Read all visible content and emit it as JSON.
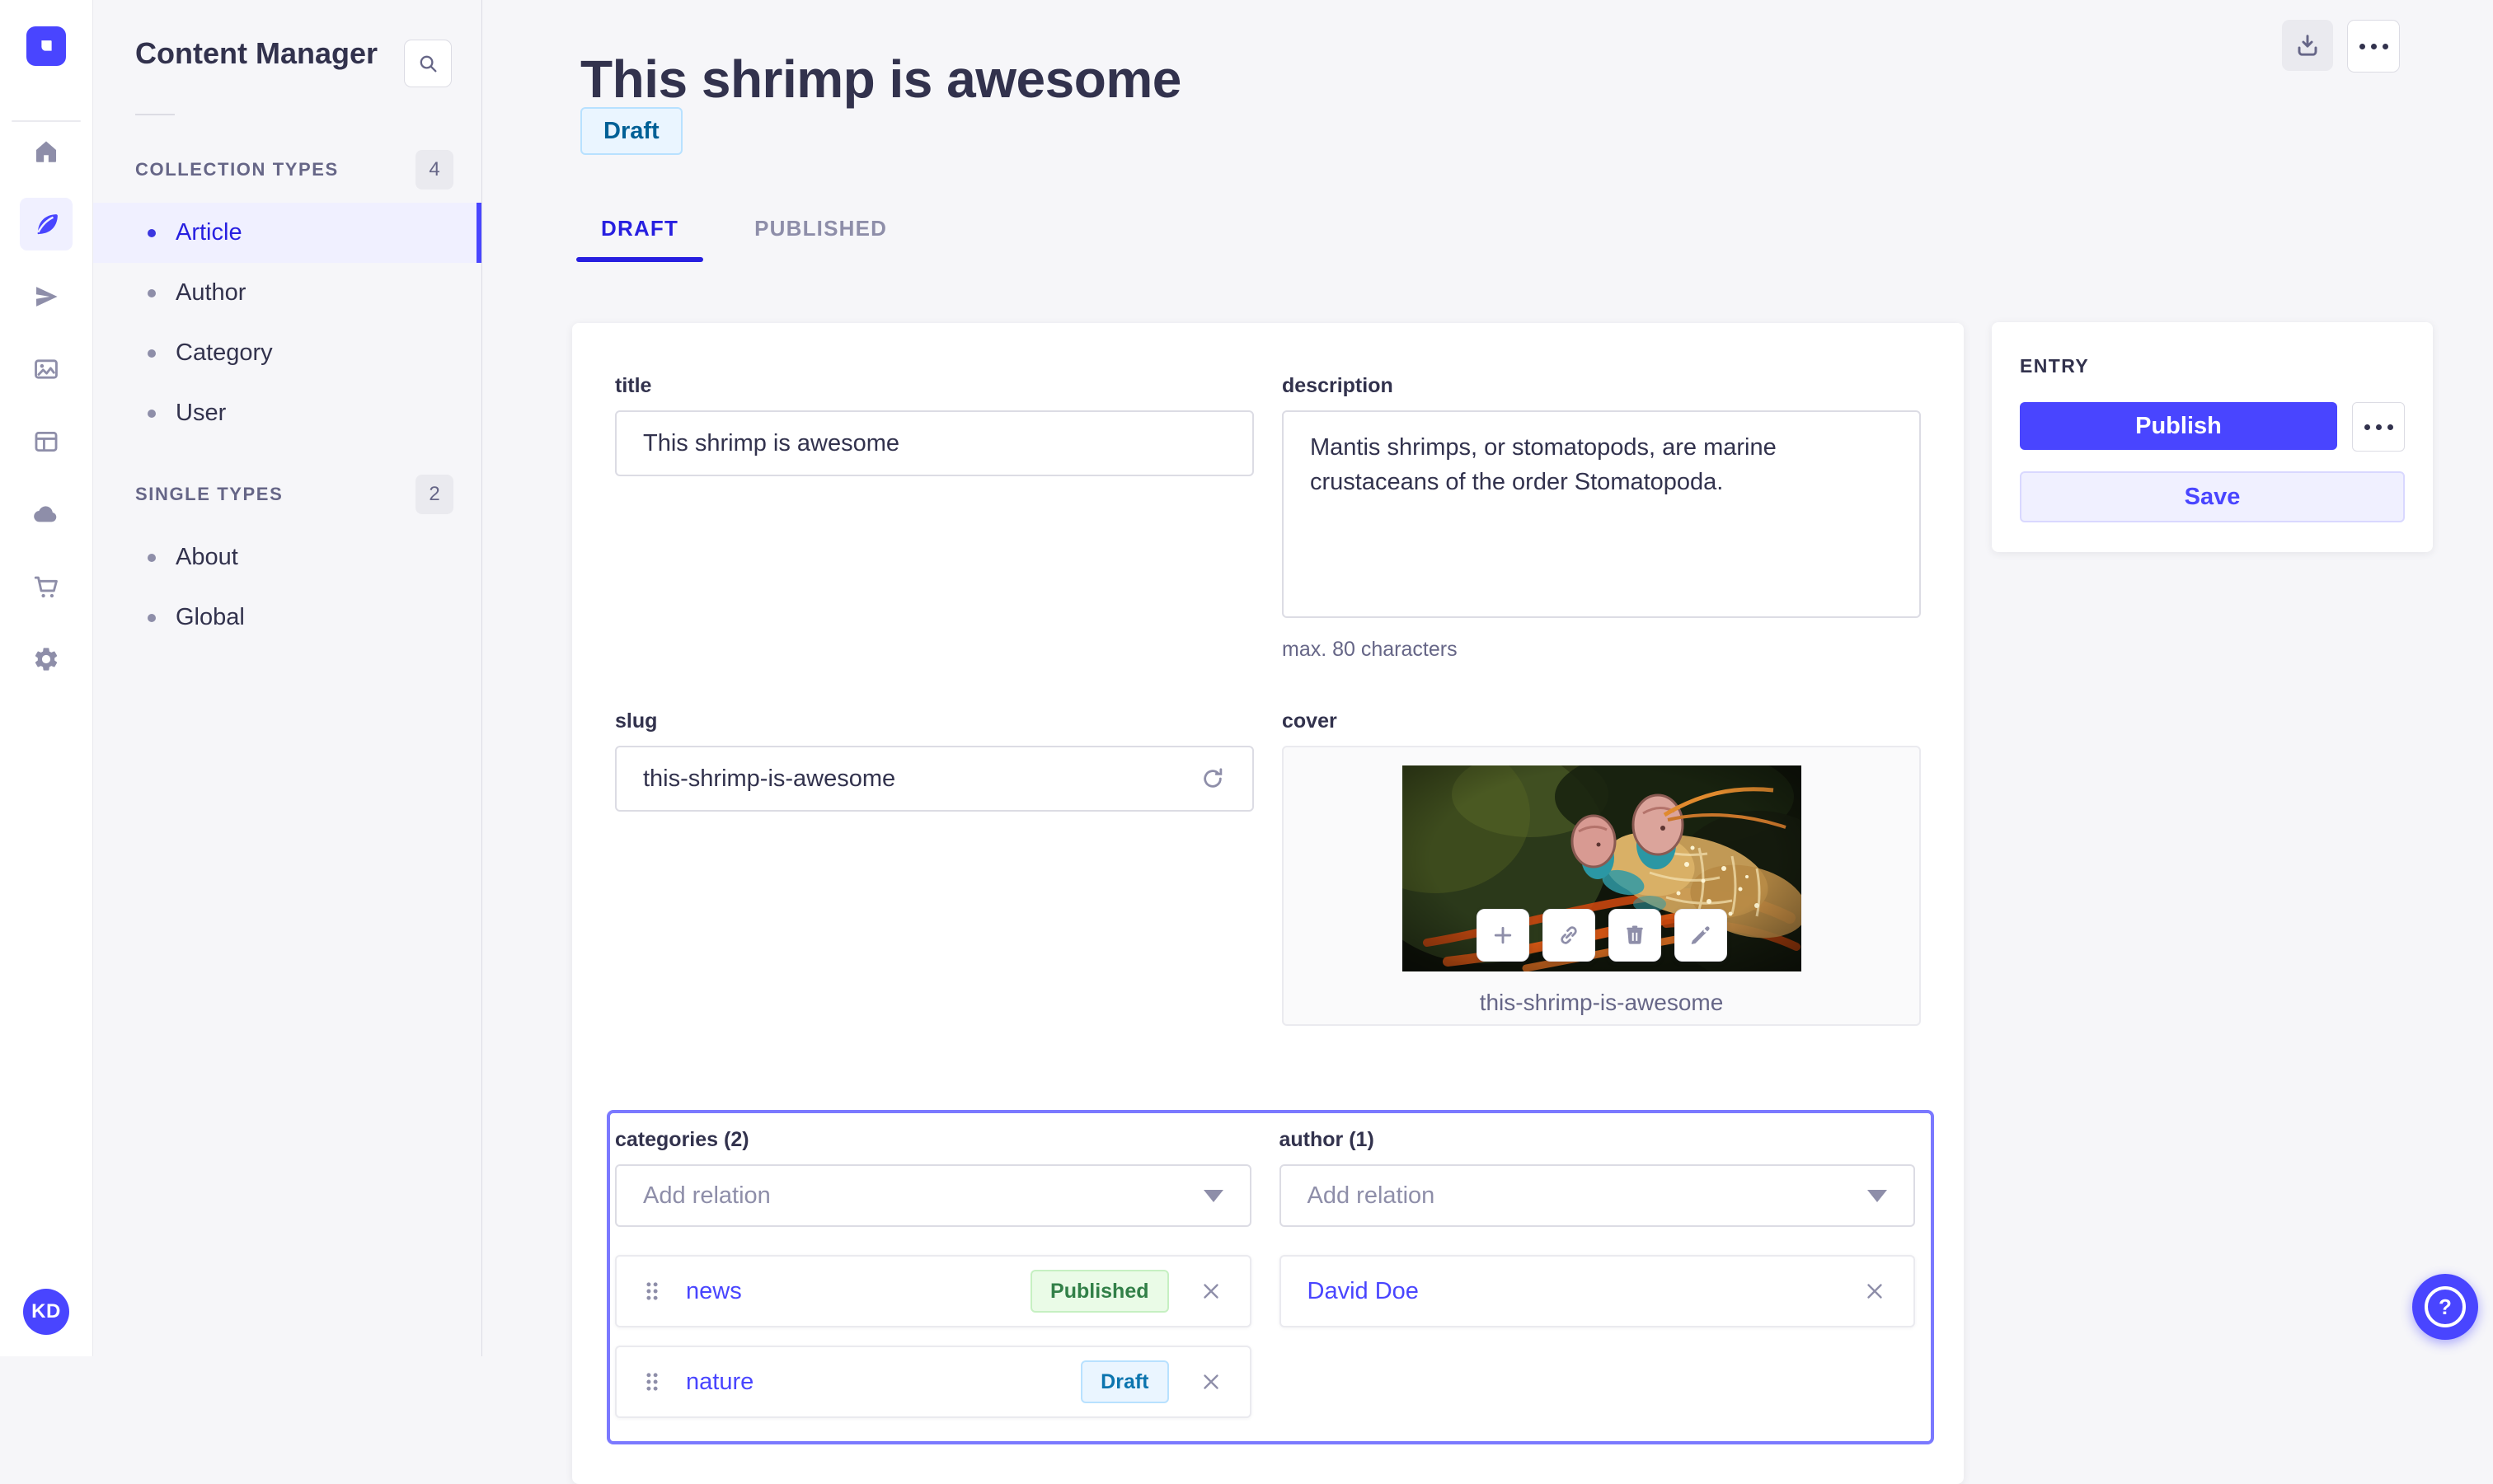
{
  "nav_rail": {
    "logo_icon": "strapi-logo",
    "icons": [
      "home-icon",
      "feather-icon",
      "paper-plane-icon",
      "media-icon",
      "layout-icon",
      "cloud-icon",
      "cart-icon",
      "gear-icon"
    ],
    "active_icon": "feather-icon",
    "avatar_initials": "KD"
  },
  "sidebar": {
    "title": "Content Manager",
    "search_icon": "search-icon",
    "collection_types": {
      "label": "COLLECTION TYPES",
      "count": "4",
      "items": [
        {
          "label": "Article",
          "active": true
        },
        {
          "label": "Author"
        },
        {
          "label": "Category"
        },
        {
          "label": "User"
        }
      ]
    },
    "single_types": {
      "label": "SINGLE TYPES",
      "count": "2",
      "items": [
        {
          "label": "About"
        },
        {
          "label": "Global"
        }
      ]
    }
  },
  "header": {
    "title": "This shrimp is awesome",
    "status_badge": "Draft",
    "tabs": [
      {
        "label": "DRAFT",
        "active": true
      },
      {
        "label": "PUBLISHED"
      }
    ],
    "download_icon": "download-icon",
    "more_icon": "ellipsis-icon"
  },
  "form": {
    "title_field": {
      "label": "title",
      "value": "This shrimp is awesome"
    },
    "description_field": {
      "label": "description",
      "value": "Mantis shrimps, or stomatopods, are marine crustaceans of the order Stomatopoda.",
      "helper": "max. 80 characters"
    },
    "slug_field": {
      "label": "slug",
      "value": "this-shrimp-is-awesome",
      "action_icon": "regenerate-icon"
    },
    "cover_field": {
      "label": "cover",
      "caption": "this-shrimp-is-awesome",
      "action_icons": [
        "plus-icon",
        "link-icon",
        "trash-icon",
        "pencil-icon"
      ]
    },
    "categories_field": {
      "label": "categories (2)",
      "placeholder": "Add relation",
      "relations": [
        {
          "name": "news",
          "status": "Published"
        },
        {
          "name": "nature",
          "status": "Draft"
        }
      ]
    },
    "author_field": {
      "label": "author (1)",
      "placeholder": "Add relation",
      "relations": [
        {
          "name": "David Doe"
        }
      ]
    }
  },
  "entry_panel": {
    "title": "ENTRY",
    "publish_label": "Publish",
    "save_label": "Save"
  },
  "help_button": {
    "icon": "question-mark-icon"
  },
  "colors": {
    "primary": "#4945ff",
    "primary_dark": "#271fe0",
    "text_dark": "#32324d",
    "text_grey": "#666687",
    "text_light_grey": "#8e8ea9",
    "border": "#dcdce4",
    "border_light": "#eaeaef",
    "bg_page": "#f6f6f9",
    "bg_lavender": "#f0f0ff",
    "relation_outline": "#7b79ff",
    "draft_bg": "#eaf5ff",
    "draft_border": "#b8e1ff",
    "draft_text": "#006096",
    "published_bg": "#eafbe7",
    "published_border": "#c6f0c2",
    "published_text": "#328048"
  }
}
